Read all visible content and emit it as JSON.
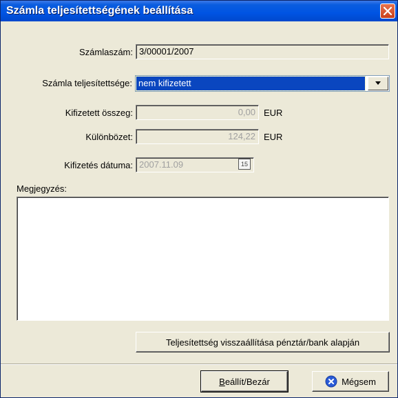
{
  "window": {
    "title": "Számla teljesítettségének beállítása"
  },
  "form": {
    "invoice_number": {
      "label": "Számlaszám:",
      "value": "3/00001/2007"
    },
    "status": {
      "label": "Számla teljesítettsége:",
      "value": "nem kifizetett"
    },
    "paid_amount": {
      "label": "Kifizetett összeg:",
      "value": "0,00",
      "unit": "EUR"
    },
    "difference": {
      "label": "Különbözet:",
      "value": "124,22",
      "unit": "EUR"
    },
    "payment_date": {
      "label": "Kifizetés dátuma:",
      "value": "2007.11.09",
      "calendar_icon_text": "15"
    },
    "note": {
      "label": "Megjegyzés:",
      "value": ""
    }
  },
  "buttons": {
    "restore": "Teljesítettség visszaállítása pénztár/bank alapján",
    "apply_close_mnemonic": "B",
    "apply_close_rest": "eállít/Bezár",
    "cancel": "Mégsem"
  },
  "icons": [
    "close-icon",
    "dropdown-arrow-icon",
    "calendar-icon",
    "cancel-icon"
  ]
}
